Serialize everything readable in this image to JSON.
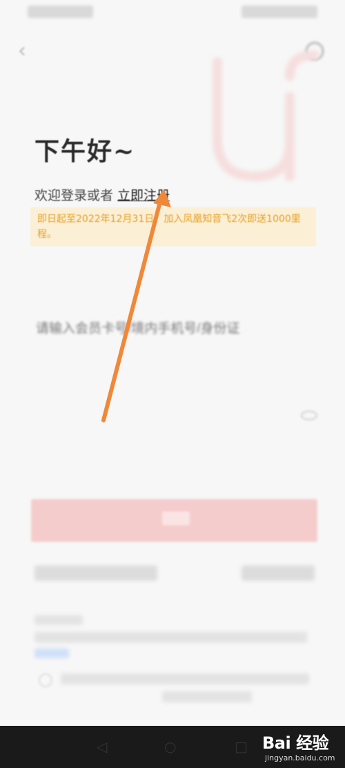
{
  "header": {
    "back_icon": "chevron-left-icon",
    "service_icon": "customer-service-icon"
  },
  "main": {
    "greeting": "下午好~",
    "welcome_text": "欢迎登录或者",
    "register_link": "立即注册",
    "promo_text": "即日起至2022年12月31日，加入凤凰知音飞2次即送1000里程。",
    "username": {
      "label": "",
      "placeholder": "请输入会员卡号/境内手机号/身份证"
    },
    "password": {
      "label": "",
      "placeholder": "",
      "eye_icon": "eye-icon"
    },
    "login_button": ""
  },
  "footer": {
    "annotation_arrow_color": "#f0883a"
  },
  "watermark": {
    "brand": "Bai 经验",
    "url": "jingyan.baidu.com"
  },
  "colors": {
    "accent": "#f5cccc",
    "promo_bg": "#fbefd6",
    "promo_text": "#e6a020",
    "arrow": "#f0883a"
  }
}
